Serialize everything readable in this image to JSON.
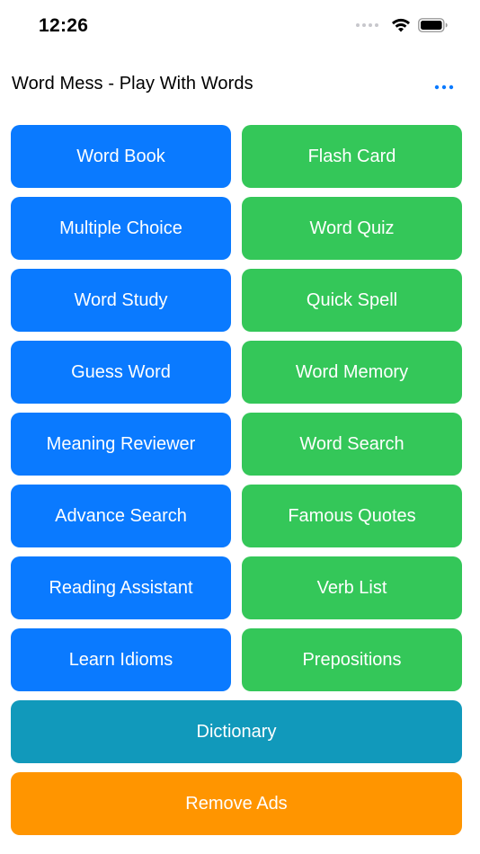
{
  "status_bar": {
    "time": "12:26"
  },
  "header": {
    "title": "Word Mess - Play With Words",
    "more_icon": "ellipsis-icon"
  },
  "menu": {
    "left": [
      "Word Book",
      "Multiple Choice",
      "Word Study",
      "Guess Word",
      "Meaning Reviewer",
      "Advance Search",
      "Reading Assistant",
      "Learn Idioms"
    ],
    "right": [
      "Flash Card",
      "Word Quiz",
      "Quick Spell",
      "Word Memory",
      "Word Search",
      "Famous Quotes",
      "Verb List",
      "Prepositions"
    ],
    "dictionary": "Dictionary",
    "remove_ads": "Remove Ads"
  },
  "colors": {
    "blue": "#0a7aff",
    "green": "#34c759",
    "teal": "#1199bb",
    "orange": "#ff9500",
    "accent": "#0a7aff"
  }
}
